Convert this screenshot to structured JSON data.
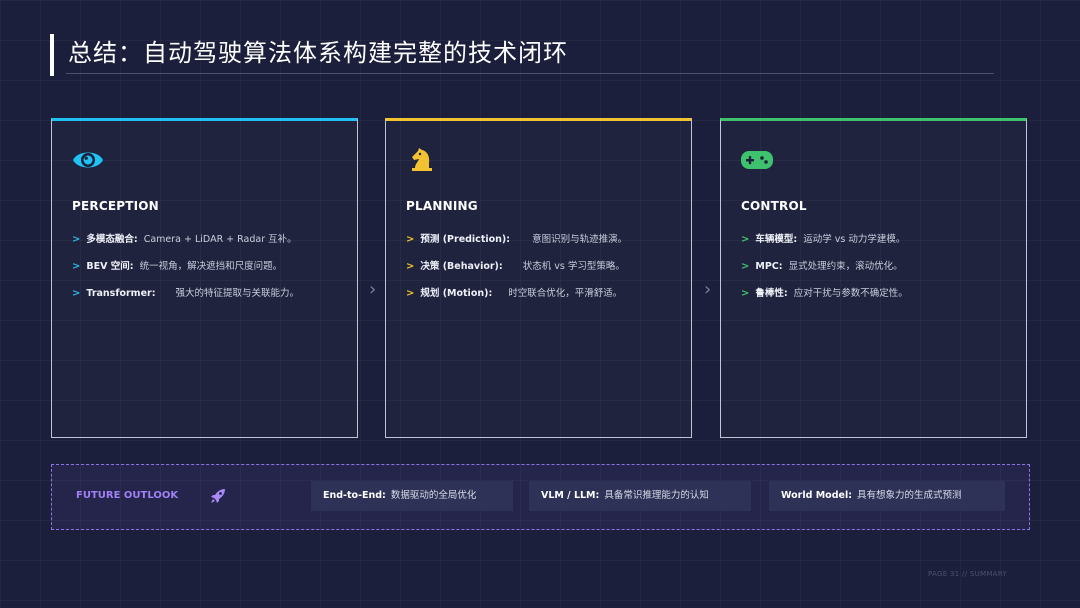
{
  "title": "总结：自动驾驶算法体系构建完整的技术闭环",
  "colors": {
    "perception_accent": "#1fc2f2",
    "planning_accent": "#f2c230",
    "control_accent": "#3fc26e",
    "outlook_accent": "#9f80f5"
  },
  "cards": [
    {
      "icon": "eye-icon",
      "title": "PERCEPTION",
      "items": [
        {
          "key": "多模态融合:",
          "value": "Camera + LiDAR + Radar 互补。"
        },
        {
          "key": "BEV 空间:",
          "value": "统一视角，解决遮挡和尺度问题。"
        },
        {
          "key": "Transformer:",
          "value": "强大的特征提取与关联能力。"
        }
      ]
    },
    {
      "icon": "chess-knight-icon",
      "title": "PLANNING",
      "items": [
        {
          "key": "预测 (Prediction):",
          "value": "意图识别与轨迹推演。"
        },
        {
          "key": "决策 (Behavior):",
          "value": "状态机 vs 学习型策略。"
        },
        {
          "key": "规划 (Motion):",
          "value": "时空联合优化，平滑舒适。"
        }
      ]
    },
    {
      "icon": "gamepad-icon",
      "title": "CONTROL",
      "items": [
        {
          "key": "车辆模型:",
          "value": "运动学 vs 动力学建模。"
        },
        {
          "key": "MPC:",
          "value": "显式处理约束，滚动优化。"
        },
        {
          "key": "鲁棒性:",
          "value": "应对干扰与参数不确定性。"
        }
      ]
    }
  ],
  "outlook": {
    "label": "FUTURE OUTLOOK",
    "icon": "rocket-icon",
    "items": [
      {
        "key": "End-to-End:",
        "value": "数据驱动的全局优化"
      },
      {
        "key": "VLM / LLM:",
        "value": "具备常识推理能力的认知"
      },
      {
        "key": "World Model:",
        "value": "具有想象力的生成式预测"
      }
    ]
  },
  "footer": "PAGE 31 // SUMMARY"
}
